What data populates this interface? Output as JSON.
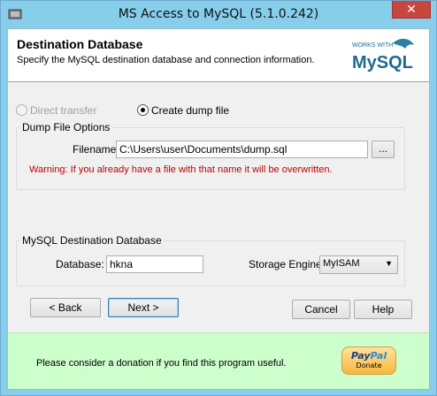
{
  "window": {
    "title": "MS Access to MySQL (5.1.0.242)",
    "close_label": "✕"
  },
  "header": {
    "title": "Destination Database",
    "subtitle": "Specify the MySQL destination database and connection information.",
    "logo_top": "WORKS WITH",
    "logo_main": "MySQL"
  },
  "transfer": {
    "direct_label": "Direct transfer",
    "dump_label": "Create dump file",
    "selected": "dump"
  },
  "dump_options": {
    "group_label": "Dump File Options",
    "filename_label": "Filename:",
    "filename_value": "C:\\Users\\user\\Documents\\dump.sql",
    "browse_label": "...",
    "warning": "Warning: If you already have a file with that name it will be overwritten."
  },
  "mysql_dest": {
    "group_label": "MySQL Destination Database",
    "database_label": "Database:",
    "database_value": "hkna",
    "engine_label": "Storage Engine:",
    "engine_value": "MyISAM"
  },
  "buttons": {
    "back": "< Back",
    "next": "Next >",
    "cancel": "Cancel",
    "help": "Help"
  },
  "donation": {
    "text": "Please consider a donation if you find this program useful.",
    "paypal_pay": "Pay",
    "paypal_pal": "Pal",
    "paypal_donate": "Donate"
  },
  "colors": {
    "titlebar": "#87CEEB",
    "warning": "#C00000",
    "donation_bg": "#CCFFCC",
    "close": "#C7463E"
  }
}
